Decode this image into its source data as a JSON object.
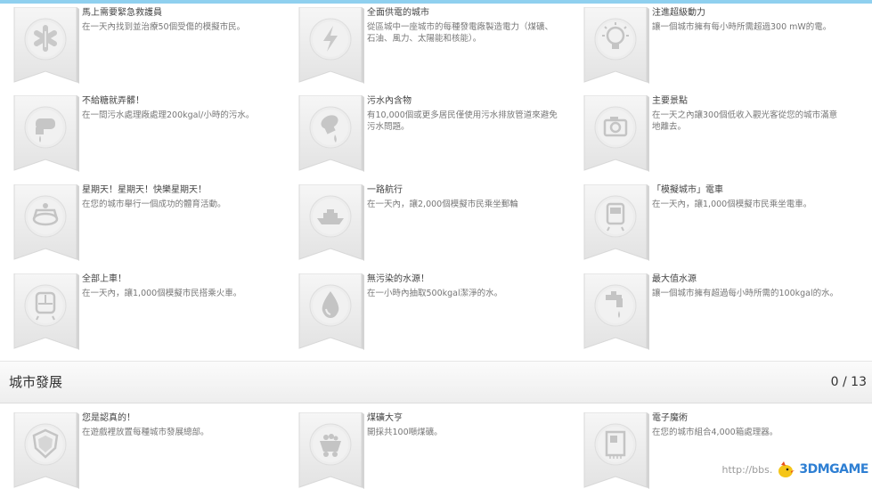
{
  "sections": [
    {
      "achievements": [
        {
          "title": "馬上需要緊急救護員",
          "desc": "在一天內找到並治療50個受傷的模擬市民。",
          "icon": "medical-star-icon"
        },
        {
          "title": "全面供電的城市",
          "desc": "從區城中一座城市的每種發電廠製造電力（煤礦、石油、風力、太陽能和核能）。",
          "icon": "lightning-icon"
        },
        {
          "title": "注進超級動力",
          "desc": "讓一個城市擁有每小時所需超過300 mW的電。",
          "icon": "lightbulb-icon"
        },
        {
          "title": "不給糖就弄髒！",
          "desc": "在一間污水處理廠處理200kgal/小時的污水。",
          "icon": "sewage-pipe-icon"
        },
        {
          "title": "污水內含物",
          "desc": "有10,000個或更多居民僅使用污水排放管道來避免污水問題。",
          "icon": "waste-pipe-icon"
        },
        {
          "title": "主要景點",
          "desc": "在一天之內讓300個低收入觀光客從您的城市滿意地離去。",
          "icon": "camera-icon"
        },
        {
          "title": "星期天！星期天！快樂星期天！",
          "desc": "在您的城市舉行一個成功的體育活動。",
          "icon": "stadium-icon"
        },
        {
          "title": "一路航行",
          "desc": "在一天內，讓2,000個模擬市民乘坐郵輪",
          "icon": "cruise-ship-icon"
        },
        {
          "title": "「模擬城市」電車",
          "desc": "在一天內，讓1,000個模擬市民乘坐電車。",
          "icon": "tram-icon"
        },
        {
          "title": "全部上車！",
          "desc": "在一天內，讓1,000個模擬市民搭乘火車。",
          "icon": "train-icon"
        },
        {
          "title": "無污染的水源！",
          "desc": "在一小時內抽取500kgal潔淨的水。",
          "icon": "water-drop-icon"
        },
        {
          "title": "最大值水源",
          "desc": "讓一個城市擁有超過每小時所需的100kgal的水。",
          "icon": "faucet-icon"
        }
      ]
    },
    {
      "name": "城市發展",
      "count": "0 / 13",
      "achievements": [
        {
          "title": "您是認真的！",
          "desc": "在遊戲裡放置每種城市發展總部。",
          "icon": "shield-icon"
        },
        {
          "title": "煤礦大亨",
          "desc": "開採共100噸煤礦。",
          "icon": "mine-cart-icon"
        },
        {
          "title": "電子魔術",
          "desc": "在您的城市組合4,000箱處理器。",
          "icon": "processor-icon"
        }
      ]
    }
  ],
  "watermark": {
    "url": "http://bbs.",
    "logo": "3DMGAME"
  }
}
